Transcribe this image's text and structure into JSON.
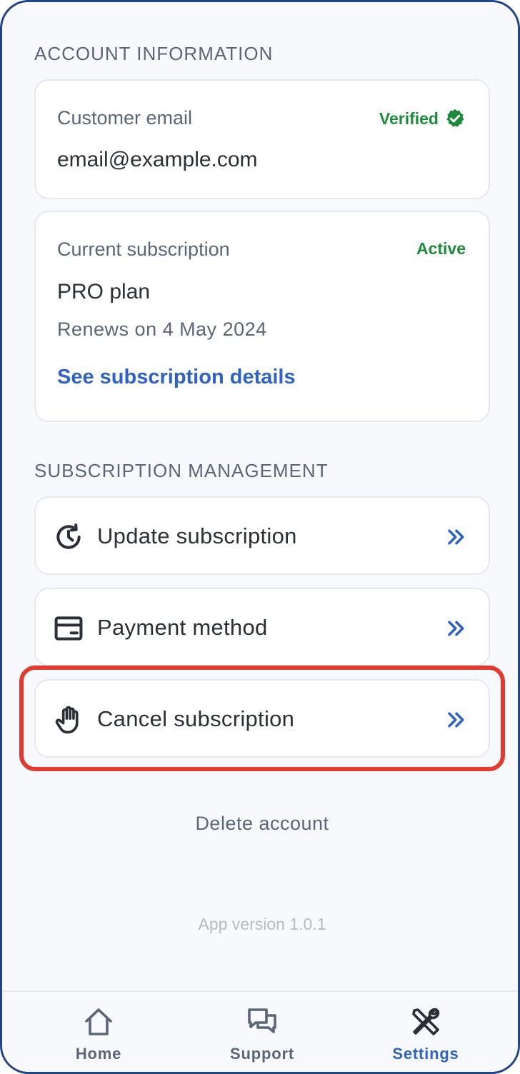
{
  "account": {
    "section_title": "ACCOUNT INFORMATION",
    "email_card": {
      "label": "Customer email",
      "value": "email@example.com",
      "status": "Verified",
      "status_icon": "verified-badge-icon"
    },
    "subscription_card": {
      "label": "Current subscription",
      "status": "Active",
      "plan": "PRO plan",
      "renewal": "Renews on 4 May 2024",
      "details_link": "See subscription details"
    }
  },
  "management": {
    "section_title": "SUBSCRIPTION MANAGEMENT",
    "items": [
      {
        "label": "Update subscription",
        "icon": "clock-refresh-icon"
      },
      {
        "label": "Payment method",
        "icon": "card-icon"
      },
      {
        "label": "Cancel subscription",
        "icon": "hand-stop-icon"
      }
    ]
  },
  "delete_account": "Delete account",
  "app_version": "App version 1.0.1",
  "tabs": [
    {
      "label": "Home",
      "icon": "home-icon",
      "active": false
    },
    {
      "label": "Support",
      "icon": "chat-icon",
      "active": false
    },
    {
      "label": "Settings",
      "icon": "tools-icon",
      "active": true
    }
  ],
  "colors": {
    "accent": "#2f62c5",
    "success": "#1e8a3c",
    "highlight": "#e23a2e",
    "frame": "#23438e"
  }
}
